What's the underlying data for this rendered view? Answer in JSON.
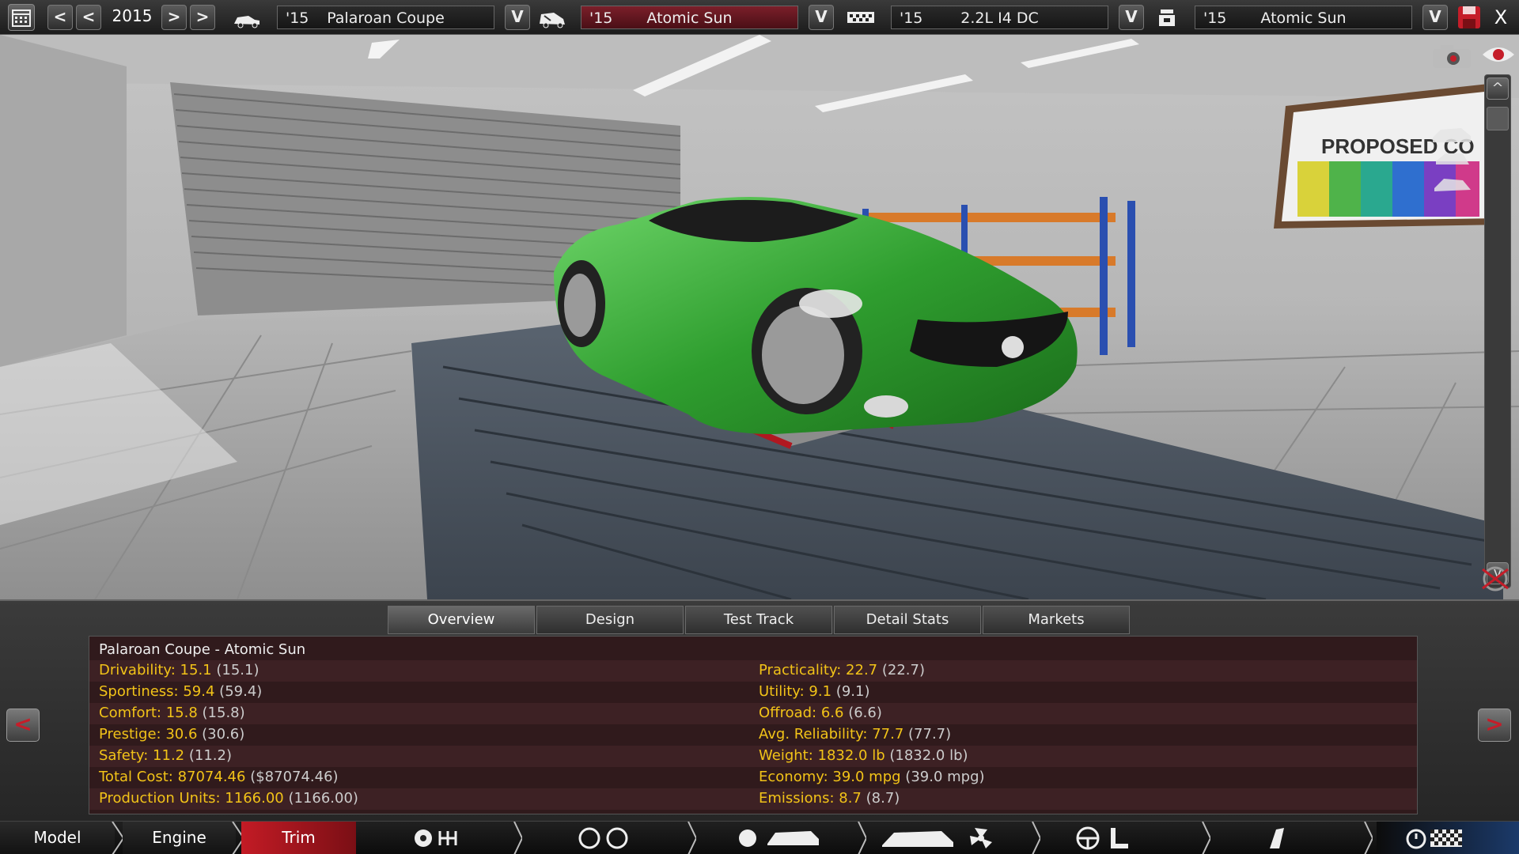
{
  "topbar": {
    "year": "2015",
    "year_prev_fast": "<",
    "year_prev": "<",
    "year_next": ">",
    "year_next_fast": ">",
    "model": {
      "year": "'15",
      "name": "Palaroan Coupe"
    },
    "trim": {
      "year": "'15",
      "name": "Atomic Sun"
    },
    "engine": {
      "year": "'15",
      "name": "2.2L I4 DC"
    },
    "family": {
      "year": "'15",
      "name": "Atomic Sun"
    },
    "dropdown_glyph": "V",
    "close_glyph": "X"
  },
  "viewport": {
    "poster_text": "PROPOSED CO",
    "car_color": "#2f9e2f",
    "scroll_up": "^",
    "scroll_down": "v"
  },
  "tabs": [
    "Overview",
    "Design",
    "Test Track",
    "Detail Stats",
    "Markets"
  ],
  "active_tab": "Overview",
  "stats": {
    "title": "Palaroan Coupe - Atomic Sun",
    "left": [
      {
        "label": "Drivability: 15.1",
        "value": "(15.1)"
      },
      {
        "label": "Sportiness: 59.4",
        "value": "(59.4)"
      },
      {
        "label": "Comfort: 15.8",
        "value": "(15.8)"
      },
      {
        "label": "Prestige: 30.6",
        "value": "(30.6)"
      },
      {
        "label": "Safety: 11.2",
        "value": "(11.2)"
      },
      {
        "label": "Total Cost: 87074.46",
        "value": "($87074.46)"
      },
      {
        "label": "Production Units: 1166.00",
        "value": "(1166.00)"
      }
    ],
    "right": [
      {
        "label": "Practicality: 22.7",
        "value": "(22.7)"
      },
      {
        "label": "Utility: 9.1",
        "value": "(9.1)"
      },
      {
        "label": "Offroad: 6.6",
        "value": "(6.6)"
      },
      {
        "label": "Avg. Reliability: 77.7",
        "value": "(77.7)"
      },
      {
        "label": "Weight: 1832.0 lb",
        "value": "(1832.0 lb)"
      },
      {
        "label": "Economy: 39.0 mpg",
        "value": "(39.0 mpg)"
      },
      {
        "label": "Emissions: 8.7",
        "value": "(8.7)"
      }
    ],
    "prev_arrow": "<",
    "next_arrow": ">"
  },
  "nav": {
    "model": "Model",
    "engine": "Engine",
    "trim": "Trim",
    "active": "Trim"
  },
  "colors": {
    "stat_label": "#f2c318",
    "accent_red": "#c51d29",
    "trim_active": "#b01820"
  }
}
